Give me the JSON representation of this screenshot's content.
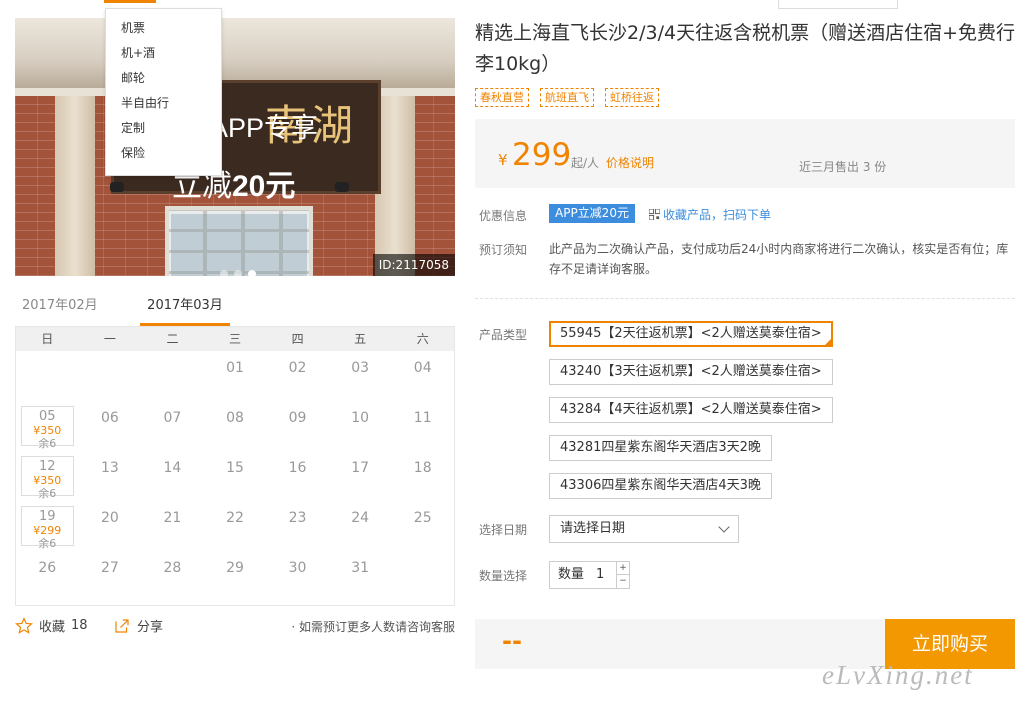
{
  "menu": {
    "items": [
      "机票",
      "机+酒",
      "邮轮",
      "半自由行",
      "定制",
      "保险"
    ]
  },
  "hero": {
    "sign_text": "南湖",
    "promo_line1": "APP专享",
    "promo_line2_prefix": "立减",
    "promo_line2_amount": "20元",
    "id_tag": "ID:2117058"
  },
  "calendar": {
    "prev_month": "2017年02月",
    "current_month": "2017年03月",
    "weekdays": [
      "日",
      "一",
      "二",
      "三",
      "四",
      "五",
      "六"
    ],
    "days": [
      {
        "d": ""
      },
      {
        "d": ""
      },
      {
        "d": ""
      },
      {
        "d": "01"
      },
      {
        "d": "02"
      },
      {
        "d": "03"
      },
      {
        "d": "04"
      },
      {
        "d": "05",
        "price": "¥350",
        "remain": "余6"
      },
      {
        "d": "06"
      },
      {
        "d": "07"
      },
      {
        "d": "08"
      },
      {
        "d": "09"
      },
      {
        "d": "10"
      },
      {
        "d": "11"
      },
      {
        "d": "12",
        "price": "¥350",
        "remain": "余6"
      },
      {
        "d": "13"
      },
      {
        "d": "14"
      },
      {
        "d": "15"
      },
      {
        "d": "16"
      },
      {
        "d": "17"
      },
      {
        "d": "18"
      },
      {
        "d": "19",
        "price": "¥299",
        "remain": "余6"
      },
      {
        "d": "20"
      },
      {
        "d": "21"
      },
      {
        "d": "22"
      },
      {
        "d": "23"
      },
      {
        "d": "24"
      },
      {
        "d": "25"
      },
      {
        "d": "26"
      },
      {
        "d": "27"
      },
      {
        "d": "28"
      },
      {
        "d": "29"
      },
      {
        "d": "30"
      },
      {
        "d": "31"
      },
      {
        "d": ""
      }
    ]
  },
  "footer": {
    "favorite_label": "收藏",
    "favorite_count": "18",
    "share_label": "分享",
    "note": "· 如需预订更多人数请咨询客服"
  },
  "product": {
    "title": "精选上海直飞长沙2/3/4天往返含税机票（赠送酒店住宿+免费行李10kg）",
    "tags": [
      "春秋直营",
      "航班直飞",
      "虹桥往返"
    ],
    "currency": "¥",
    "price": "299",
    "price_unit": "起/人",
    "price_note": "价格说明",
    "sold": "近三月售出 3 份",
    "discount_label": "优惠信息",
    "app_badge": "APP立减20元",
    "qr_link": "收藏产品，扫码下单",
    "notice_label": "预订须知",
    "notice": "此产品为二次确认产品，支付成功后24小时内商家将进行二次确认，核实是否有位；库存不足请详询客服。",
    "type_label": "产品类型",
    "options": [
      "55945【2天往返机票】<2人赠送莫泰住宿>",
      "43240【3天往返机票】<2人赠送莫泰住宿>",
      "43284【4天往返机票】<2人赠送莫泰住宿>",
      "43281四星紫东阁华天酒店3天2晚",
      "43306四星紫东阁华天酒店4天3晚"
    ],
    "date_label": "选择日期",
    "date_placeholder": "请选择日期",
    "qty_label": "数量选择",
    "qty_inner_label": "数量",
    "qty_value": "1",
    "total": "--",
    "buy_label": "立即购买",
    "watermark": "eLvXing.net"
  },
  "colors": {
    "accent": "#f08300",
    "link": "#3c8dde",
    "buy": "#f39800"
  }
}
